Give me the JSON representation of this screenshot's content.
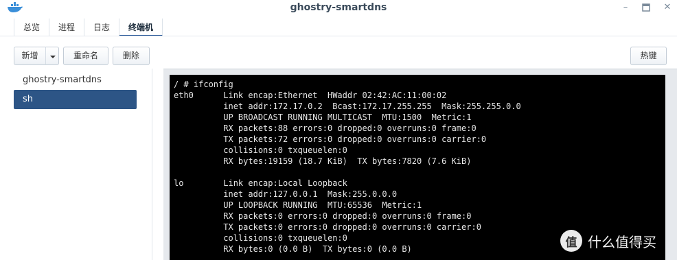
{
  "window": {
    "title": "ghostry-smartdns",
    "logo_icon": "docker-whale-icon",
    "controls": [
      "minimize-icon",
      "maximize-icon",
      "close-icon"
    ]
  },
  "tabs": [
    {
      "label": "总览"
    },
    {
      "label": "进程"
    },
    {
      "label": "日志"
    },
    {
      "label": "终端机"
    }
  ],
  "toolbar": {
    "new_label": "新增",
    "rename_label": "重命名",
    "delete_label": "删除",
    "hotkey_label": "热键"
  },
  "sidebar": {
    "items": [
      {
        "label": "ghostry-smartdns"
      },
      {
        "label": "sh"
      }
    ]
  },
  "terminal": {
    "lines": [
      "/ # ifconfig",
      "eth0      Link encap:Ethernet  HWaddr 02:42:AC:11:00:02",
      "          inet addr:172.17.0.2  Bcast:172.17.255.255  Mask:255.255.0.0",
      "          UP BROADCAST RUNNING MULTICAST  MTU:1500  Metric:1",
      "          RX packets:88 errors:0 dropped:0 overruns:0 frame:0",
      "          TX packets:72 errors:0 dropped:0 overruns:0 carrier:0",
      "          collisions:0 txqueuelen:0",
      "          RX bytes:19159 (18.7 KiB)  TX bytes:7820 (7.6 KiB)",
      "",
      "lo        Link encap:Local Loopback",
      "          inet addr:127.0.0.1  Mask:255.0.0.0",
      "          UP LOOPBACK RUNNING  MTU:65536  Metric:1",
      "          RX packets:0 errors:0 dropped:0 overruns:0 frame:0",
      "          TX packets:0 errors:0 dropped:0 overruns:0 carrier:0",
      "          collisions:0 txqueuelen:0",
      "          RX bytes:0 (0.0 B)  TX bytes:0 (0.0 B)"
    ]
  },
  "watermark": {
    "badge": "值",
    "text": "什么值得买"
  }
}
